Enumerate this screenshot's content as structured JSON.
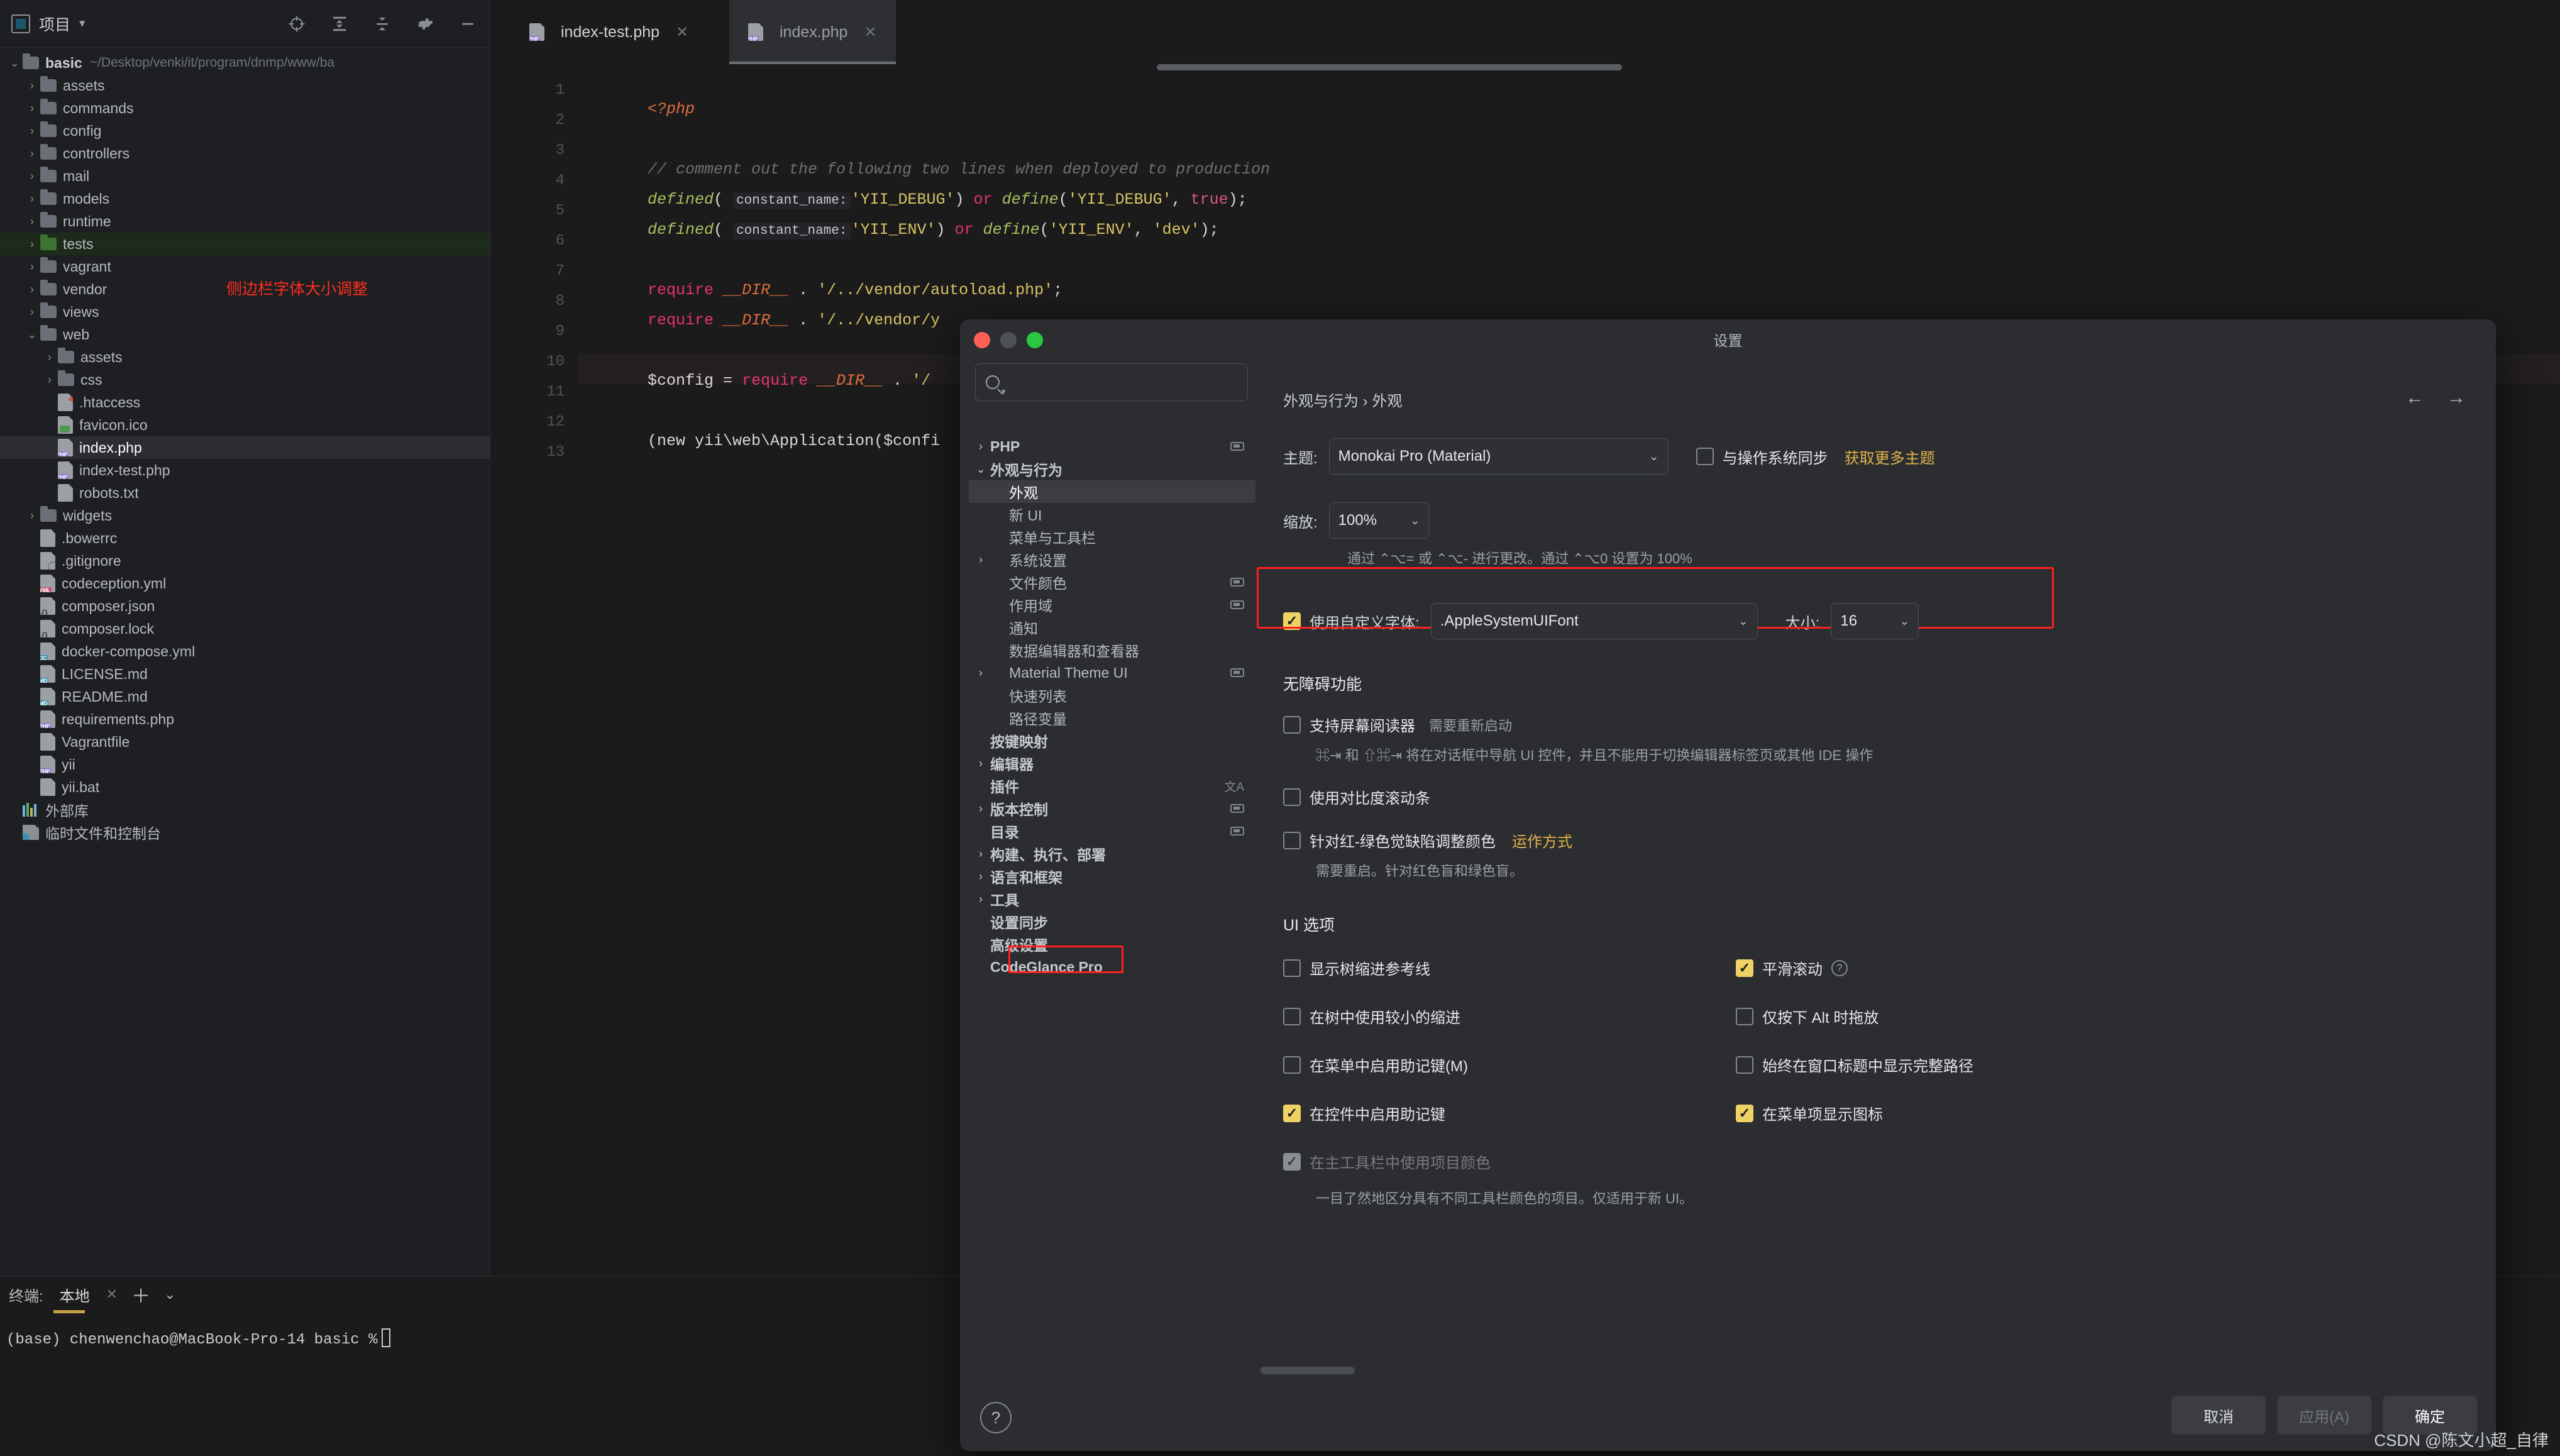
{
  "project_panel": {
    "title": "项目",
    "root": {
      "name": "basic",
      "path": "~/Desktop/venki/it/program/dnmp/www/ba"
    },
    "annotation": "侧边栏字体大小调整",
    "items": [
      {
        "label": "assets",
        "type": "folder",
        "indent": 2,
        "arrow": ">"
      },
      {
        "label": "commands",
        "type": "folder",
        "indent": 2,
        "arrow": ">"
      },
      {
        "label": "config",
        "type": "folder",
        "indent": 2,
        "arrow": ">"
      },
      {
        "label": "controllers",
        "type": "folder",
        "indent": 2,
        "arrow": ">"
      },
      {
        "label": "mail",
        "type": "folder",
        "indent": 2,
        "arrow": ">"
      },
      {
        "label": "models",
        "type": "folder",
        "indent": 2,
        "arrow": ">"
      },
      {
        "label": "runtime",
        "type": "folder",
        "indent": 2,
        "arrow": ">"
      },
      {
        "label": "tests",
        "type": "folder-green",
        "indent": 2,
        "arrow": ">",
        "state": "sel-green"
      },
      {
        "label": "vagrant",
        "type": "folder",
        "indent": 2,
        "arrow": ">"
      },
      {
        "label": "vendor",
        "type": "folder",
        "indent": 2,
        "arrow": ">"
      },
      {
        "label": "views",
        "type": "folder",
        "indent": 2,
        "arrow": ">"
      },
      {
        "label": "web",
        "type": "folder",
        "indent": 2,
        "arrow": "v"
      },
      {
        "label": "assets",
        "type": "folder",
        "indent": 3,
        "arrow": ">"
      },
      {
        "label": "css",
        "type": "folder",
        "indent": 3,
        "arrow": ">"
      },
      {
        "label": ".htaccess",
        "type": "file-htaccess",
        "indent": 3,
        "arrow": ""
      },
      {
        "label": "favicon.ico",
        "type": "file-img",
        "indent": 3,
        "arrow": ""
      },
      {
        "label": "index.php",
        "type": "file-php",
        "indent": 3,
        "arrow": "",
        "state": "sel-gray"
      },
      {
        "label": "index-test.php",
        "type": "file-php",
        "indent": 3,
        "arrow": ""
      },
      {
        "label": "robots.txt",
        "type": "file-txt",
        "indent": 3,
        "arrow": ""
      },
      {
        "label": "widgets",
        "type": "folder",
        "indent": 2,
        "arrow": ">"
      },
      {
        "label": ".bowerrc",
        "type": "file-txt",
        "indent": 2,
        "arrow": ""
      },
      {
        "label": ".gitignore",
        "type": "file-git",
        "indent": 2,
        "arrow": ""
      },
      {
        "label": "codeception.yml",
        "type": "file-yml",
        "indent": 2,
        "arrow": ""
      },
      {
        "label": "composer.json",
        "type": "file-json",
        "indent": 2,
        "arrow": ""
      },
      {
        "label": "composer.lock",
        "type": "file-json",
        "indent": 2,
        "arrow": ""
      },
      {
        "label": "docker-compose.yml",
        "type": "file-dc",
        "indent": 2,
        "arrow": ""
      },
      {
        "label": "LICENSE.md",
        "type": "file-md",
        "indent": 2,
        "arrow": ""
      },
      {
        "label": "README.md",
        "type": "file-md",
        "indent": 2,
        "arrow": ""
      },
      {
        "label": "requirements.php",
        "type": "file-php",
        "indent": 2,
        "arrow": ""
      },
      {
        "label": "Vagrantfile",
        "type": "file-txt",
        "indent": 2,
        "arrow": ""
      },
      {
        "label": "yii",
        "type": "file-php",
        "indent": 2,
        "arrow": ""
      },
      {
        "label": "yii.bat",
        "type": "file-txt",
        "indent": 2,
        "arrow": ""
      },
      {
        "label": "外部库",
        "type": "library",
        "indent": 1,
        "arrow": ""
      },
      {
        "label": "临时文件和控制台",
        "type": "scratch",
        "indent": 1,
        "arrow": ""
      }
    ]
  },
  "editor": {
    "tabs": [
      {
        "label": "index-test.php",
        "active": false
      },
      {
        "label": "index.php",
        "active": true
      }
    ],
    "line_numbers": [
      "1",
      "2",
      "3",
      "4",
      "5",
      "6",
      "7",
      "8",
      "9",
      "10",
      "11",
      "12",
      "13"
    ],
    "code": {
      "l1_tag": "<?php",
      "l3_comment": "// comment out the following two lines when deployed to production",
      "l4": {
        "fn": "defined",
        "hint": "constant_name:",
        "s1": "'YII_DEBUG'",
        "kw": "or",
        "fn2": "define",
        "s2": "'YII_DEBUG'",
        "val": "true"
      },
      "l5": {
        "fn": "defined",
        "hint": "constant_name:",
        "s1": "'YII_ENV'",
        "kw": "or",
        "fn2": "define",
        "s2": "'YII_ENV'",
        "val": "'dev'"
      },
      "l7": {
        "kw": "require",
        "const": "__DIR__",
        "str": "'/../vendor/autoload.php'"
      },
      "l8": {
        "kw": "require",
        "const": "__DIR__",
        "str": "'/../vendor/y"
      },
      "l10": {
        "var": "$config",
        "kw": "require",
        "const": "__DIR__",
        "str": "'/"
      },
      "l12": {
        "text": "(new yii\\web\\Application($confi"
      }
    }
  },
  "terminal": {
    "label": "终端:",
    "tab": "本地",
    "prompt": "(base) chenwenchao@MacBook-Pro-14 basic %"
  },
  "dialog": {
    "title": "设置",
    "search_placeholder": "",
    "breadcrumb": "外观与行为  ›  外观",
    "tree": [
      {
        "label": "PHP",
        "arrow": ">",
        "level": 1,
        "bold": true,
        "chip": true
      },
      {
        "label": "外观与行为",
        "arrow": "v",
        "level": 1,
        "bold": true,
        "chip": false
      },
      {
        "label": "外观",
        "arrow": "",
        "level": 2,
        "bold": false,
        "chip": false,
        "active": true
      },
      {
        "label": "新 UI",
        "arrow": "",
        "level": 2,
        "bold": false,
        "chip": false
      },
      {
        "label": "菜单与工具栏",
        "arrow": "",
        "level": 2,
        "bold": false,
        "chip": false
      },
      {
        "label": "系统设置",
        "arrow": ">",
        "level": 2,
        "bold": false,
        "chip": false
      },
      {
        "label": "文件颜色",
        "arrow": "",
        "level": 2,
        "bold": false,
        "chip": true
      },
      {
        "label": "作用域",
        "arrow": "",
        "level": 2,
        "bold": false,
        "chip": true
      },
      {
        "label": "通知",
        "arrow": "",
        "level": 2,
        "bold": false,
        "chip": false
      },
      {
        "label": "数据编辑器和查看器",
        "arrow": "",
        "level": 2,
        "bold": false,
        "chip": false
      },
      {
        "label": "Material Theme UI",
        "arrow": ">",
        "level": 2,
        "bold": false,
        "chip": true
      },
      {
        "label": "快速列表",
        "arrow": "",
        "level": 2,
        "bold": false,
        "chip": false
      },
      {
        "label": "路径变量",
        "arrow": "",
        "level": 2,
        "bold": false,
        "chip": false
      },
      {
        "label": "按键映射",
        "arrow": "",
        "level": 1,
        "bold": true,
        "chip": false
      },
      {
        "label": "编辑器",
        "arrow": ">",
        "level": 1,
        "bold": true,
        "chip": false
      },
      {
        "label": "插件",
        "arrow": "",
        "level": 1,
        "bold": true,
        "chip": false,
        "lang": true
      },
      {
        "label": "版本控制",
        "arrow": ">",
        "level": 1,
        "bold": true,
        "chip": true
      },
      {
        "label": "目录",
        "arrow": "",
        "level": 1,
        "bold": true,
        "chip": true
      },
      {
        "label": "构建、执行、部署",
        "arrow": ">",
        "level": 1,
        "bold": true,
        "chip": false
      },
      {
        "label": "语言和框架",
        "arrow": ">",
        "level": 1,
        "bold": true,
        "chip": false
      },
      {
        "label": "工具",
        "arrow": ">",
        "level": 1,
        "bold": true,
        "chip": false
      },
      {
        "label": "设置同步",
        "arrow": "",
        "level": 1,
        "bold": true,
        "chip": false
      },
      {
        "label": "高级设置",
        "arrow": "",
        "level": 1,
        "bold": true,
        "chip": false
      },
      {
        "label": "CodeGlance Pro",
        "arrow": "",
        "level": 1,
        "bold": true,
        "chip": false
      }
    ],
    "theme": {
      "label": "主题:",
      "value": "Monokai Pro (Material)",
      "sync_os_label": "与操作系统同步",
      "sync_os_checked": false,
      "more_themes_link": "获取更多主题"
    },
    "zoom": {
      "label": "缩放:",
      "value": "100%",
      "hint": "通过 ⌃⌥= 或 ⌃⌥- 进行更改。通过 ⌃⌥0 设置为 100%"
    },
    "custom_font": {
      "checkbox_label": "使用自定义字体:",
      "checked": true,
      "font_value": ".AppleSystemUIFont",
      "size_label": "大小:",
      "size_value": "16"
    },
    "accessibility": {
      "heading": "无障碍功能",
      "items": [
        {
          "label": "支持屏幕阅读器",
          "checked": false,
          "muted": "需要重新启动",
          "hint": "⌘⇥ 和 ⇧⌘⇥ 将在对话框中导航 UI 控件，并且不能用于切换编辑器标签页或其他 IDE 操作"
        },
        {
          "label": "使用对比度滚动条",
          "checked": false,
          "muted": "",
          "hint": ""
        },
        {
          "label": "针对红-绿色觉缺陷调整颜色",
          "checked": false,
          "link": "运作方式",
          "hint": "需要重启。针对红色盲和绿色盲。"
        }
      ]
    },
    "ui_options": {
      "heading": "UI 选项",
      "left": [
        {
          "label": "显示树缩进参考线",
          "checked": false
        },
        {
          "label": "在树中使用较小的缩进",
          "checked": false
        },
        {
          "label": "在菜单中启用助记键(M)",
          "checked": false
        },
        {
          "label": "在控件中启用助记键",
          "checked": true
        },
        {
          "label": "在主工具栏中使用项目颜色",
          "checked": true,
          "disabled": true
        }
      ],
      "right": [
        {
          "label": "平滑滚动",
          "checked": true,
          "help": true
        },
        {
          "label": "仅按下 Alt 时拖放",
          "checked": false
        },
        {
          "label": "始终在窗口标题中显示完整路径",
          "checked": false
        },
        {
          "label": "在菜单项显示图标",
          "checked": true
        }
      ],
      "footer_hint": "一目了然地区分具有不同工具栏颜色的项目。仅适用于新 UI。"
    },
    "buttons": {
      "help": "?",
      "cancel": "取消",
      "apply": "应用(A)",
      "ok": "确定"
    }
  },
  "watermark": "CSDN @陈文小超_自律",
  "colors": {
    "accent_yellow": "#f0d264",
    "link_yellow": "#e0b44a",
    "annotation_red": "#ff2d1f",
    "selection_green": "#1d2b1d"
  }
}
